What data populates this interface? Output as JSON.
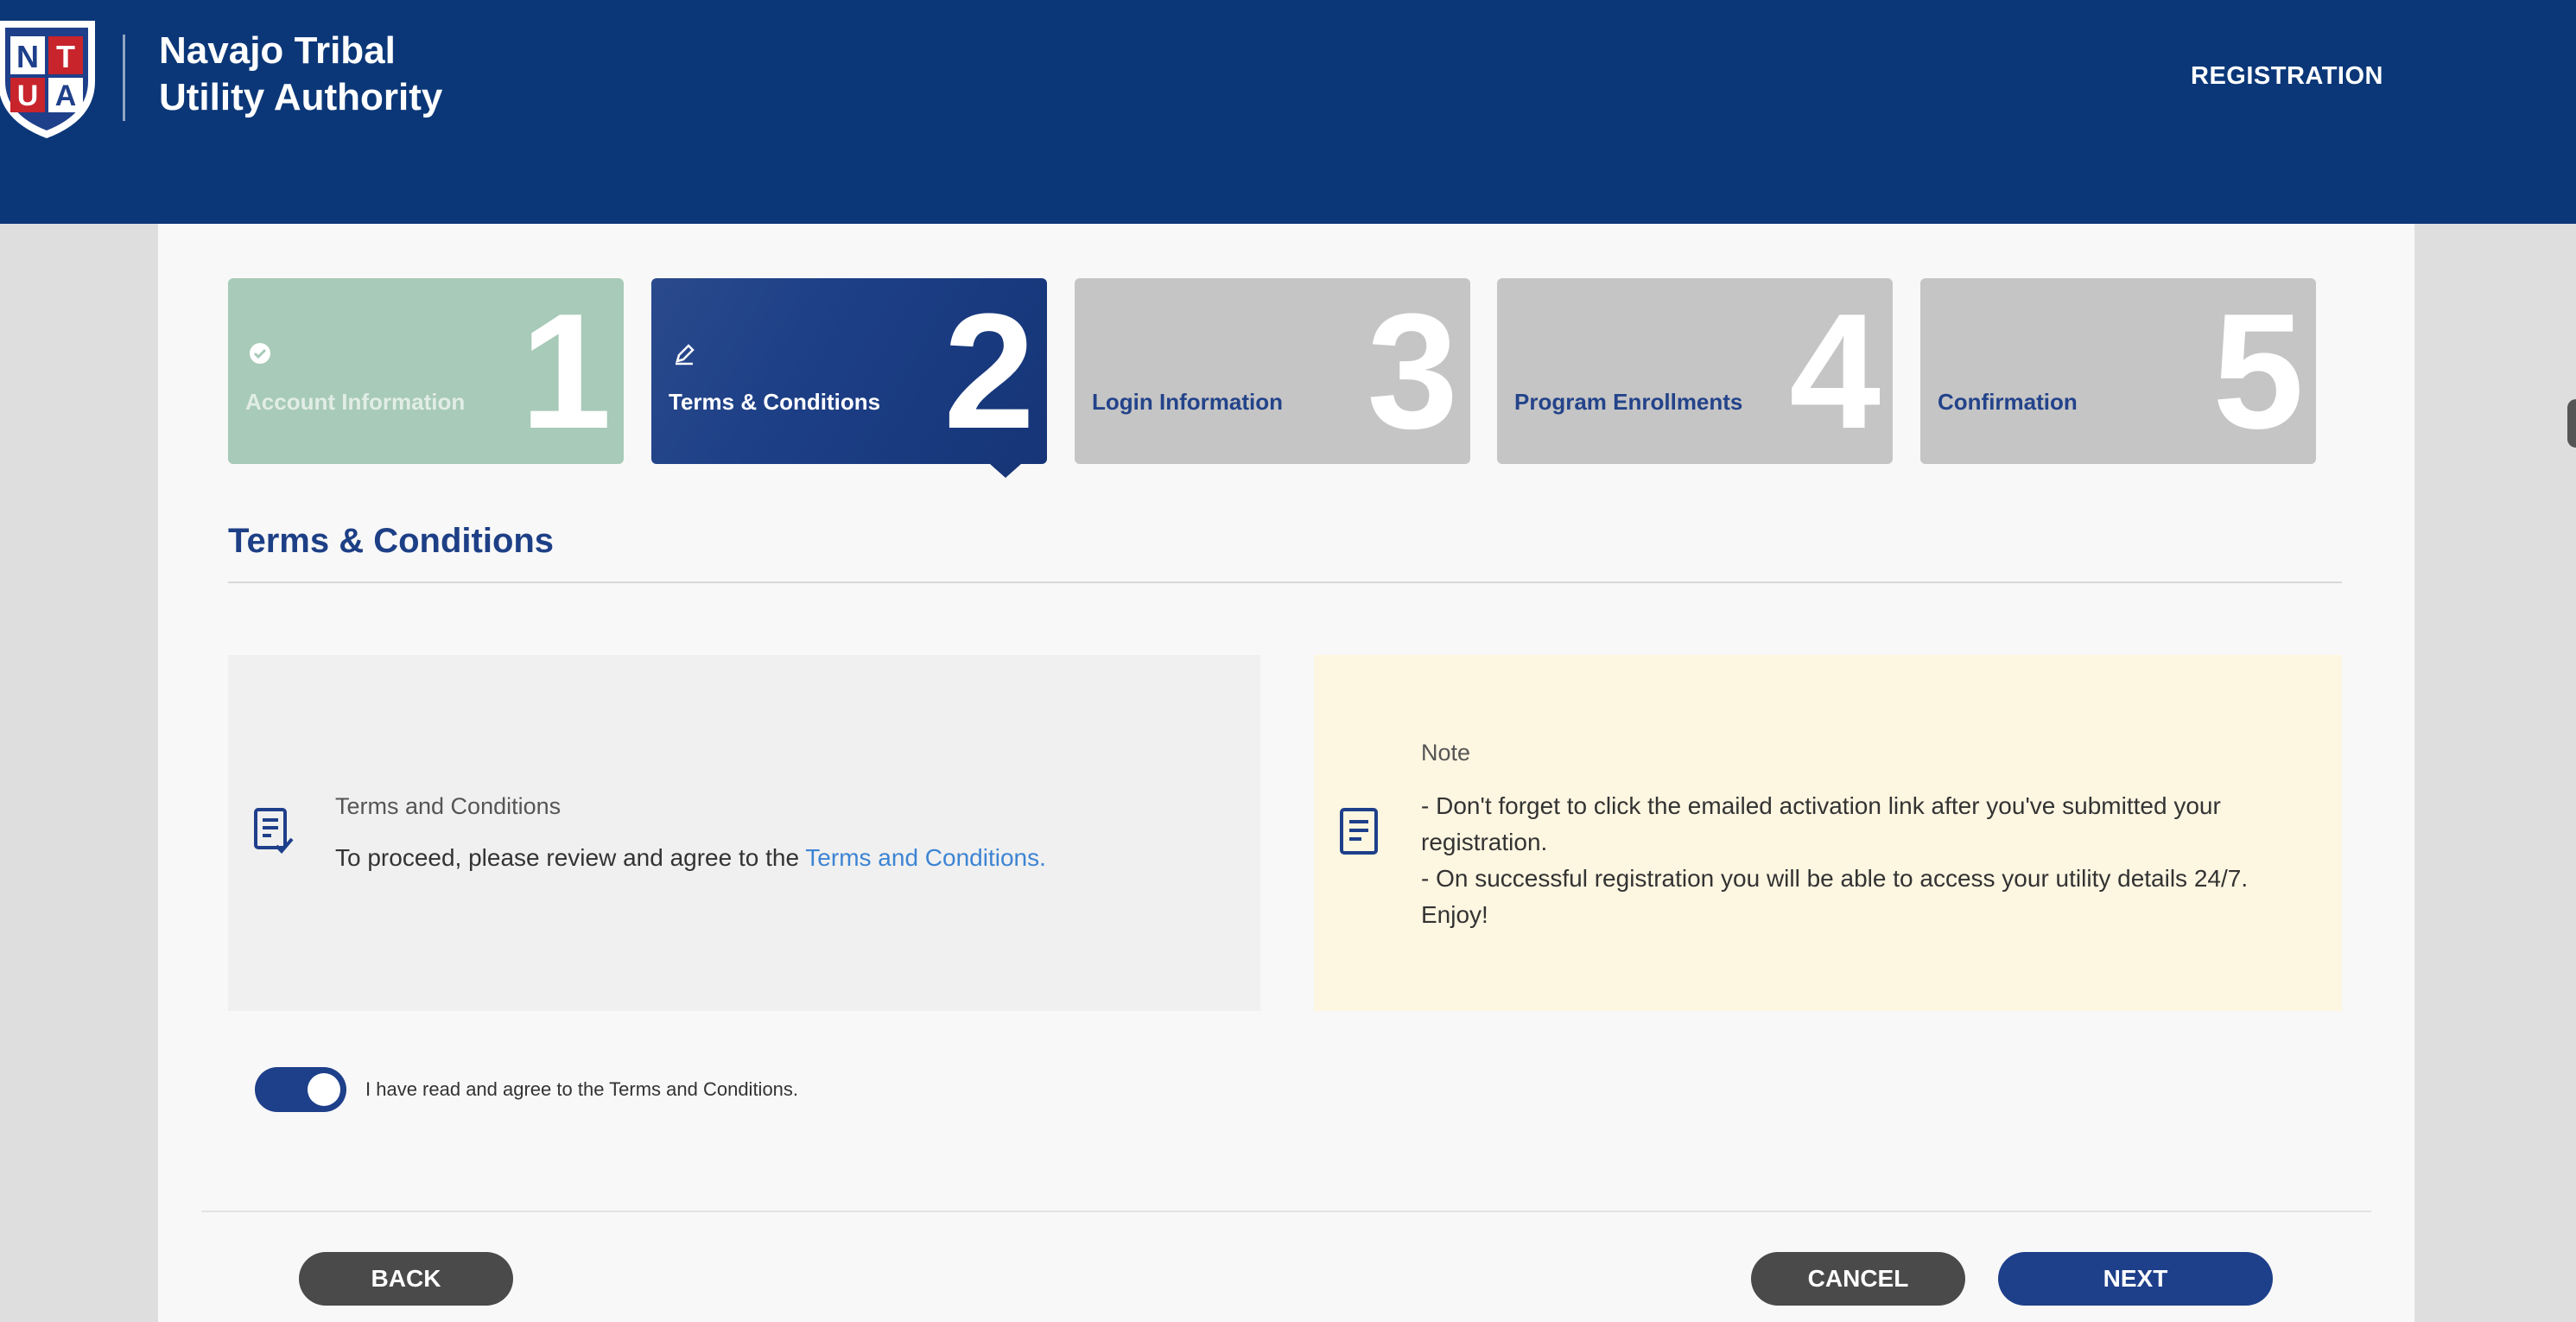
{
  "header": {
    "org_name_line1": "Navajo Tribal",
    "org_name_line2": "Utility Authority",
    "logo_letters": "NTUA",
    "nav_registration": "REGISTRATION",
    "background_color": "#0b3778"
  },
  "steps": [
    {
      "number": "1",
      "label": "Account Information",
      "state": "complete",
      "icon": "check-circle-icon"
    },
    {
      "number": "2",
      "label": "Terms & Conditions",
      "state": "active",
      "icon": "edit-icon"
    },
    {
      "number": "3",
      "label": "Login Information",
      "state": "pending"
    },
    {
      "number": "4",
      "label": "Program Enrollments",
      "state": "pending"
    },
    {
      "number": "5",
      "label": "Confirmation",
      "state": "pending"
    }
  ],
  "section": {
    "title": "Terms & Conditions"
  },
  "terms": {
    "heading": "Terms and Conditions",
    "text": "To proceed, please review and agree to the ",
    "link_text": "Terms and Conditions."
  },
  "note": {
    "heading": "Note",
    "line1": "- Don't forget to click the emailed activation link after you've submitted your registration.",
    "line2": "- On successful registration you will be able to access your utility details 24/7. Enjoy!"
  },
  "agreement": {
    "label": "I have read and agree to the Terms and Conditions.",
    "checked": true
  },
  "buttons": {
    "back": "BACK",
    "cancel": "CANCEL",
    "next": "NEXT"
  },
  "colors": {
    "primary": "#1e3f8a",
    "complete_step": "#a8cab8",
    "pending_step": "#c5c5c5",
    "note_bg": "#fdf6e1",
    "link": "#3c84d4"
  }
}
